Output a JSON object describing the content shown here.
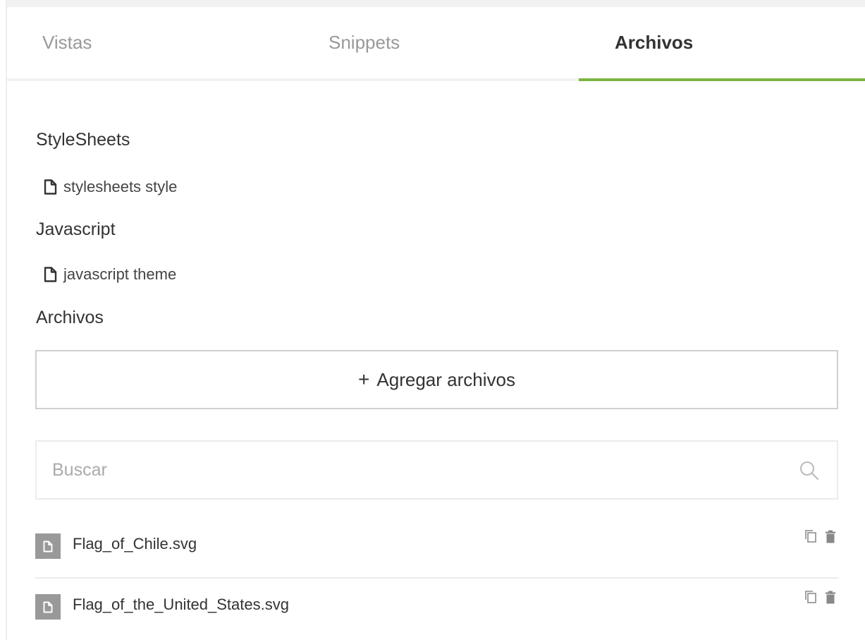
{
  "tabs": {
    "vistas": "Vistas",
    "snippets": "Snippets",
    "archivos": "Archivos",
    "active": "archivos"
  },
  "sections": {
    "stylesheets_title": "StyleSheets",
    "stylesheets_item": "stylesheets style",
    "javascript_title": "Javascript",
    "javascript_item": "javascript theme",
    "archivos_title": "Archivos"
  },
  "add_button": {
    "plus": "+",
    "label": "Agregar archivos"
  },
  "search": {
    "placeholder": "Buscar",
    "value": ""
  },
  "files": [
    {
      "name": "Flag_of_Chile.svg",
      "icon": "file-icon"
    },
    {
      "name": "Flag_of_the_United_States.svg",
      "icon": "file-icon"
    }
  ],
  "icons": {
    "file": "file-icon",
    "search": "search-icon",
    "copy": "copy-icon",
    "delete": "trash-icon"
  },
  "colors": {
    "accent": "#7cb342",
    "badge": "#999999",
    "muted_text": "#999999",
    "text": "#333333"
  }
}
